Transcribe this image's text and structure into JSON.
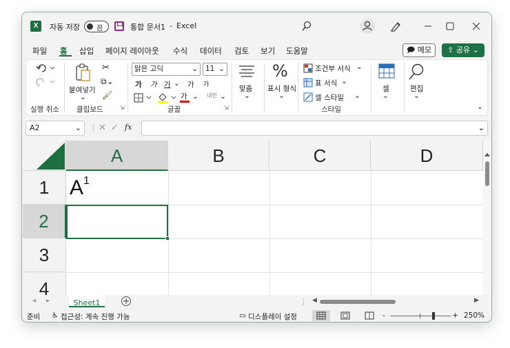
{
  "titlebar": {
    "app_icon": "X",
    "autosave_label": "자동 저장",
    "autosave_state": "끔",
    "doc_title": "통합 문서1",
    "separator": "-",
    "app_name": "Excel",
    "icons": [
      "excel-icon",
      "save-icon",
      "search-icon",
      "user-icon",
      "pen-icon",
      "minimize-icon",
      "maximize-icon",
      "close-icon"
    ]
  },
  "menu": {
    "items": [
      "파일",
      "홈",
      "삽입",
      "페이지 레이아웃",
      "수식",
      "데이터",
      "검토",
      "보기",
      "도움말"
    ],
    "active": "홈",
    "memo_label": "메모",
    "share_label": "공유"
  },
  "ribbon": {
    "undo_group_label": "실행 취소",
    "paste_label": "붙여넣기",
    "clipboard_label": "클립보드",
    "font_name": "맑은 고딕",
    "font_size": "11",
    "font_group_label": "글꼴",
    "bold": "가",
    "italic": "가",
    "underline": "가",
    "grow_font": "가",
    "shrink_font": "가",
    "font_color_glyph": "가",
    "phonetic": "내천",
    "align_label": "맞춤",
    "number_format_label": "표시 형식",
    "conditional_format": "조건부 서식",
    "table_format": "표 서식",
    "cell_style": "셀 스타일",
    "styles_group_label": "스타일",
    "cells_label": "셀",
    "editing_label": "편집",
    "accent_color": "#1d6f42",
    "font_color_bar": "#e00000",
    "highlight_bar": "#ffff00"
  },
  "formula": {
    "name_box": "A2",
    "fx": "fx",
    "content": ""
  },
  "grid": {
    "columns": [
      "A",
      "B",
      "C",
      "D"
    ],
    "rows": [
      "1",
      "2",
      "3",
      "4"
    ],
    "a1_text": "A",
    "a1_superscript": "1",
    "active_cell": "A2"
  },
  "sheets": {
    "tabs": [
      "Sheet1"
    ],
    "add_label": "+"
  },
  "status": {
    "ready": "준비",
    "accessibility": "접근성: 계속 진행 가능",
    "display_settings": "디스플레이 설정",
    "zoom_minus": "-",
    "zoom_plus": "+",
    "zoom_level": "250%"
  }
}
